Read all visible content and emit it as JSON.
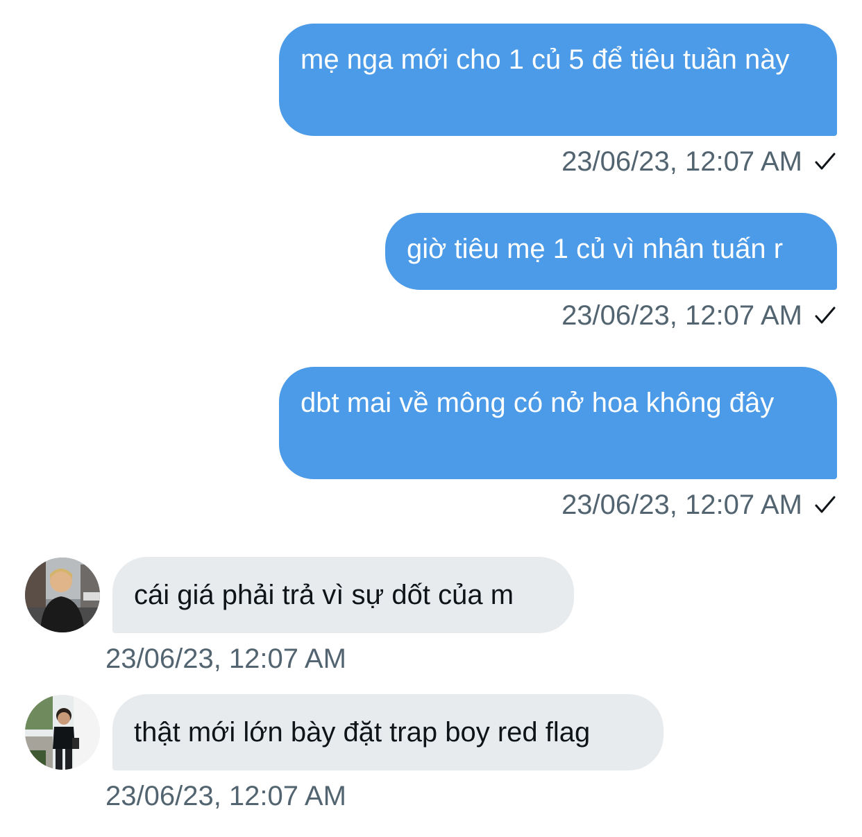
{
  "conversation": {
    "messages": [
      {
        "direction": "outgoing",
        "text": "mẹ nga mới cho 1 củ 5 để tiêu tuần này",
        "timestamp": "23/06/23, 12:07 AM",
        "status_icon": "check-icon"
      },
      {
        "direction": "outgoing",
        "text": "giờ tiêu mẹ 1 củ vì nhân tuấn r",
        "timestamp": "23/06/23, 12:07 AM",
        "status_icon": "check-icon"
      },
      {
        "direction": "outgoing",
        "text": "dbt mai về mông có nở hoa không đây",
        "timestamp": "23/06/23, 12:07 AM",
        "status_icon": "check-icon"
      },
      {
        "direction": "incoming",
        "text": "cái giá phải trả vì sự dốt của m",
        "timestamp": "23/06/23, 12:07 AM",
        "avatar_icon": "avatar-photo"
      },
      {
        "direction": "incoming",
        "text": "thật mới lớn bày đặt trap boy red flag",
        "timestamp": "23/06/23, 12:07 AM",
        "avatar_icon": "avatar-photo"
      }
    ]
  },
  "colors": {
    "outgoing_bubble": "#4c9be8",
    "incoming_bubble": "#e8ebee",
    "timestamp_text": "#536471",
    "incoming_text": "#0f1419"
  }
}
